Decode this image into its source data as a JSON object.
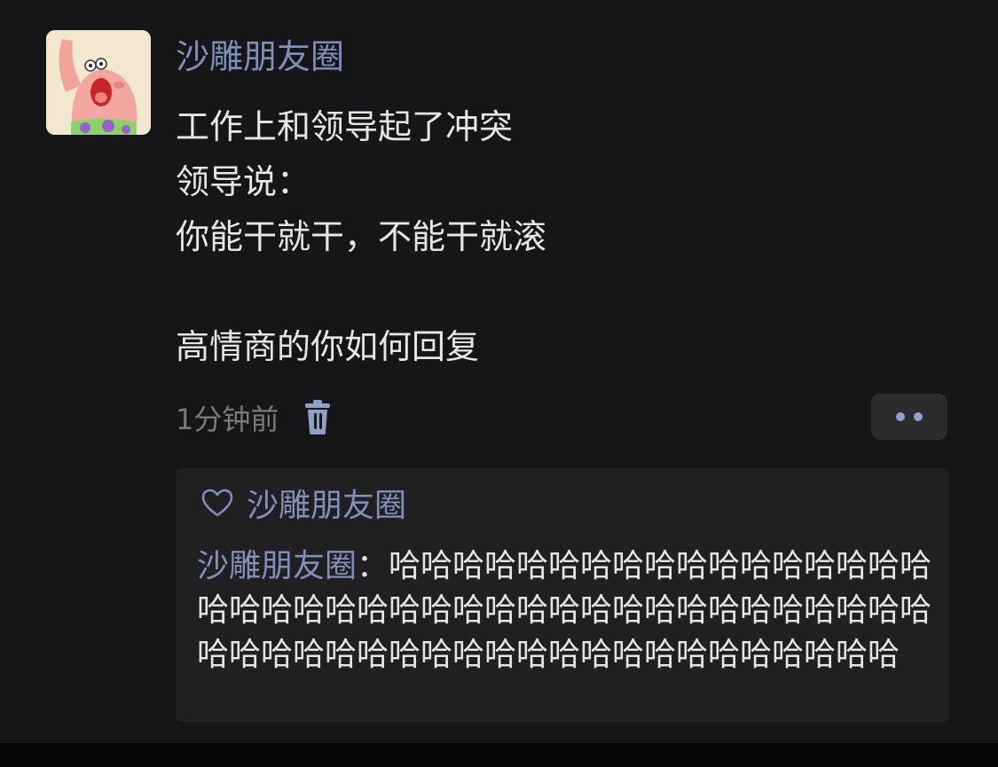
{
  "post": {
    "author": "沙雕朋友圈",
    "lines": [
      "工作上和领导起了冲突",
      "领导说：",
      "你能干就干，不能干就滚",
      "",
      "高情商的你如何回复"
    ],
    "timestamp": "1分钟前",
    "icons": {
      "delete": "trash-icon",
      "more": "more-dots-icon"
    }
  },
  "likes": {
    "icon": "heart-icon",
    "names": "沙雕朋友圈"
  },
  "comment": {
    "author": "沙雕朋友圈",
    "separator": "：",
    "text": "哈哈哈哈哈哈哈哈哈哈哈哈哈哈哈哈哈哈哈哈哈哈哈哈哈哈哈哈哈哈哈哈哈哈哈哈哈哈哈哈哈哈哈哈哈哈哈哈哈哈哈哈哈哈哈哈哈哈哈哈哈哈"
  },
  "colors": {
    "background": "#161618",
    "name_link": "#7f8fb8",
    "text": "#e6e6e6",
    "muted": "#7a7a7c",
    "comment_box": "#202022"
  }
}
